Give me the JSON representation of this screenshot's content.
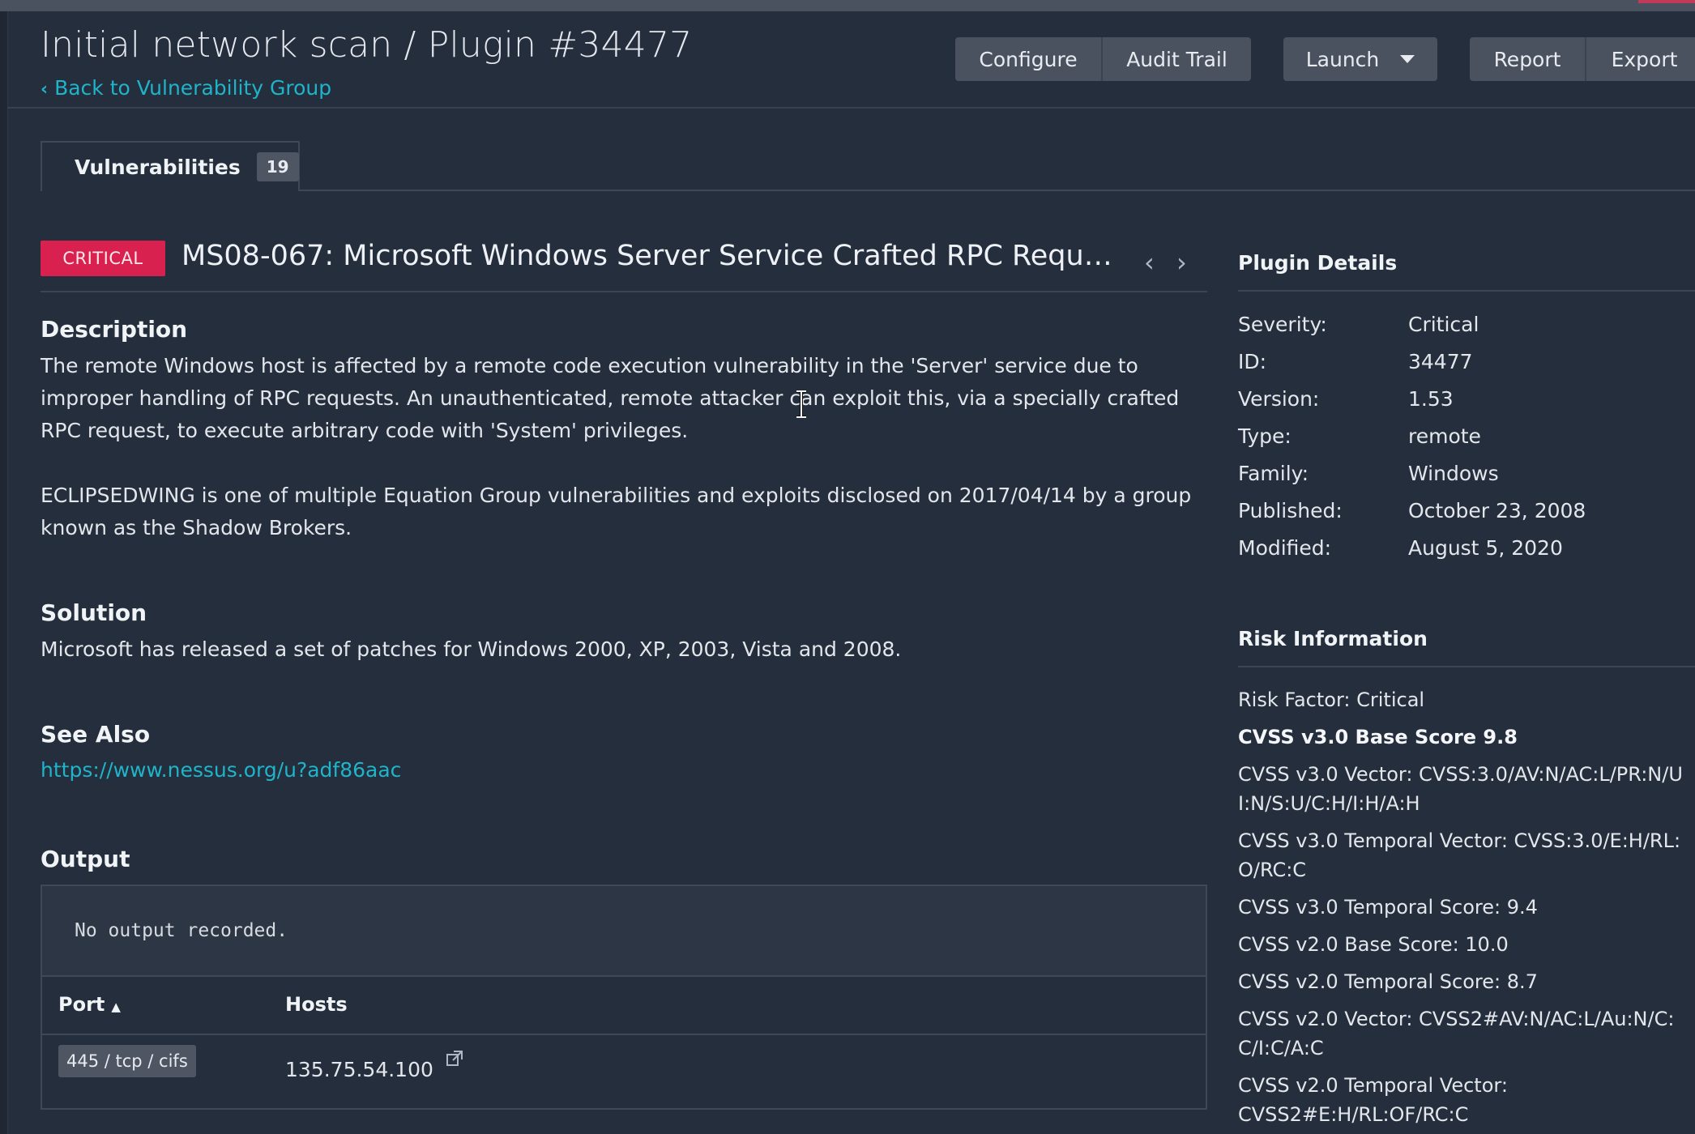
{
  "header": {
    "title": "Initial network scan / Plugin #34477",
    "back_link": "Back to Vulnerability Group",
    "buttons": {
      "configure": "Configure",
      "audit_trail": "Audit Trail",
      "launch": "Launch",
      "report": "Report",
      "export": "Export"
    }
  },
  "tab": {
    "label": "Vulnerabilities",
    "count": "19"
  },
  "vulnerability": {
    "severity_badge": "CRITICAL",
    "title": "MS08-067: Microsoft Windows Server Service Crafted RPC Request ...",
    "description_heading": "Description",
    "description_p1": "The remote Windows host is affected by a remote code execution vulnerability in the 'Server' service due to improper handling of RPC requests. An unauthenticated, remote attacker can exploit this, via a specially crafted RPC request, to execute arbitrary code with 'System' privileges.",
    "description_p2": "ECLIPSEDWING is one of multiple Equation Group vulnerabilities and exploits disclosed on 2017/04/14 by a group known as the Shadow Brokers.",
    "solution_heading": "Solution",
    "solution": "Microsoft has released a set of patches for Windows 2000, XP, 2003, Vista and 2008.",
    "see_also_heading": "See Also",
    "see_also_link": "https://www.nessus.org/u?adf86aac",
    "output_heading": "Output",
    "output_text": "No output recorded.",
    "table": {
      "port_header": "Port",
      "hosts_header": "Hosts",
      "rows": [
        {
          "port": "445 / tcp / cifs",
          "host": "135.75.54.100"
        }
      ]
    }
  },
  "plugin_details": {
    "heading": "Plugin Details",
    "rows": [
      {
        "label": "Severity:",
        "value": "Critical"
      },
      {
        "label": "ID:",
        "value": "34477"
      },
      {
        "label": "Version:",
        "value": "1.53"
      },
      {
        "label": "Type:",
        "value": "remote"
      },
      {
        "label": "Family:",
        "value": "Windows"
      },
      {
        "label": "Published:",
        "value": "October 23, 2008"
      },
      {
        "label": "Modified:",
        "value": "August 5, 2020"
      }
    ]
  },
  "risk_information": {
    "heading": "Risk Information",
    "lines": [
      "Risk Factor: Critical",
      "CVSS v3.0 Base Score 9.8",
      "CVSS v3.0 Vector: CVSS:3.0/AV:N/AC:L/PR:N/UI:N/S:U/C:H/I:H/A:H",
      "CVSS v3.0 Temporal Vector: CVSS:3.0/E:H/RL:O/RC:C",
      "CVSS v3.0 Temporal Score: 9.4",
      "CVSS v2.0 Base Score: 10.0",
      "CVSS v2.0 Temporal Score: 8.7",
      "CVSS v2.0 Vector: CVSS2#AV:N/AC:L/Au:N/C:C/I:C/A:C",
      "CVSS v2.0 Temporal Vector: CVSS2#E:H/RL:OF/RC:C"
    ]
  },
  "colors": {
    "background": "#252e3c",
    "accent_link": "#1fb4c9",
    "critical": "#d8214f",
    "button": "#4a5260"
  }
}
